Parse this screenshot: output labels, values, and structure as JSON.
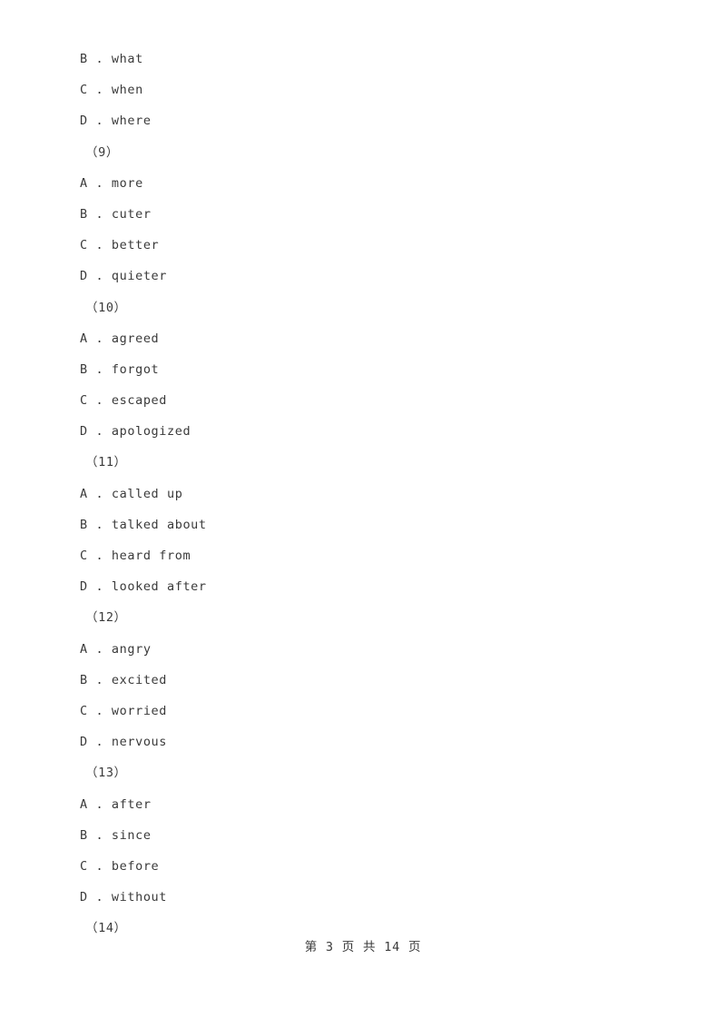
{
  "document": {
    "background_color": "#ffffff",
    "text_color": "#3a3a3a"
  },
  "body_lines": [
    {
      "kind": "option",
      "text": "B . what"
    },
    {
      "kind": "option",
      "text": "C . when"
    },
    {
      "kind": "option",
      "text": "D . where"
    },
    {
      "kind": "group",
      "text": "（9）"
    },
    {
      "kind": "option",
      "text": "A . more"
    },
    {
      "kind": "option",
      "text": "B . cuter"
    },
    {
      "kind": "option",
      "text": "C . better"
    },
    {
      "kind": "option",
      "text": "D . quieter"
    },
    {
      "kind": "group",
      "text": "（10）"
    },
    {
      "kind": "option",
      "text": "A . agreed"
    },
    {
      "kind": "option",
      "text": "B . forgot"
    },
    {
      "kind": "option",
      "text": "C . escaped"
    },
    {
      "kind": "option",
      "text": "D . apologized"
    },
    {
      "kind": "group",
      "text": "（11）"
    },
    {
      "kind": "option",
      "text": "A . called up"
    },
    {
      "kind": "option",
      "text": "B . talked about"
    },
    {
      "kind": "option",
      "text": "C . heard from"
    },
    {
      "kind": "option",
      "text": "D . looked after"
    },
    {
      "kind": "group",
      "text": "（12）"
    },
    {
      "kind": "option",
      "text": "A . angry"
    },
    {
      "kind": "option",
      "text": "B . excited"
    },
    {
      "kind": "option",
      "text": "C . worried"
    },
    {
      "kind": "option",
      "text": "D . nervous"
    },
    {
      "kind": "group",
      "text": "（13）"
    },
    {
      "kind": "option",
      "text": "A . after"
    },
    {
      "kind": "option",
      "text": "B . since"
    },
    {
      "kind": "option",
      "text": "C . before"
    },
    {
      "kind": "option",
      "text": "D . without"
    },
    {
      "kind": "group",
      "text": "（14）"
    }
  ],
  "footer": {
    "text": "第 3 页 共 14 页",
    "current_page": "3",
    "total_pages": "14"
  }
}
